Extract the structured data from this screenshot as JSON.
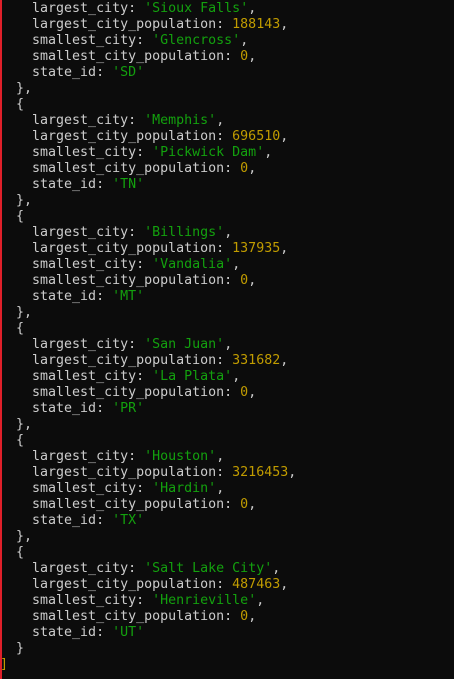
{
  "terminal": {
    "colors": {
      "background": "#0c0c0c",
      "text": "#cccccc",
      "string": "#13a10e",
      "number": "#c19c00"
    },
    "partial_first_record": {
      "largest_city": "Sioux Falls",
      "largest_city_population": 188143,
      "smallest_city": "Glencross",
      "smallest_city_population": 0,
      "state_id": "SD"
    },
    "records": [
      {
        "largest_city": "Memphis",
        "largest_city_population": 696510,
        "smallest_city": "Pickwick Dam",
        "smallest_city_population": 0,
        "state_id": "TN"
      },
      {
        "largest_city": "Billings",
        "largest_city_population": 137935,
        "smallest_city": "Vandalia",
        "smallest_city_population": 0,
        "state_id": "MT"
      },
      {
        "largest_city": "San Juan",
        "largest_city_population": 331682,
        "smallest_city": "La Plata",
        "smallest_city_population": 0,
        "state_id": "PR"
      },
      {
        "largest_city": "Houston",
        "largest_city_population": 3216453,
        "smallest_city": "Hardin",
        "smallest_city_population": 0,
        "state_id": "TX"
      },
      {
        "largest_city": "Salt Lake City",
        "largest_city_population": 487463,
        "smallest_city": "Henrieville",
        "smallest_city_population": 0,
        "state_id": "UT"
      }
    ],
    "closing_bracket": "]"
  }
}
